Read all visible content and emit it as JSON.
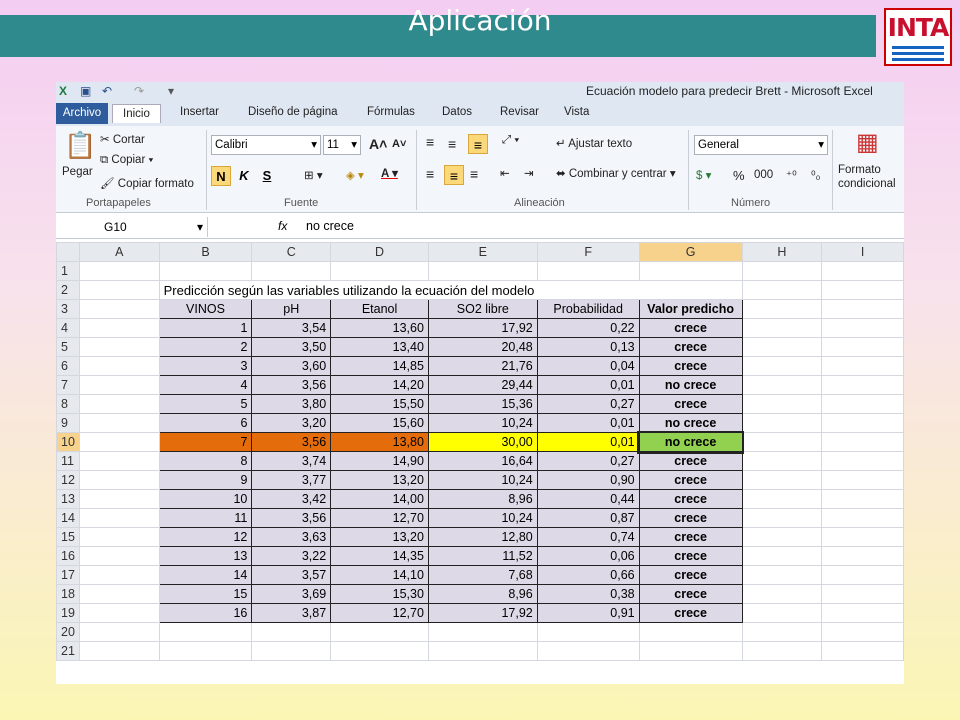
{
  "slide": {
    "title": "Aplicación",
    "logo": "INTA"
  },
  "colors": {
    "title_bar": "#2f8a8d",
    "data_fill": "#ddd9e6",
    "highlight_row": "#e56c0a",
    "highlight_yellow": "#ffff00",
    "selected_cell": "#92d050"
  },
  "window": {
    "title": "Ecuación modelo para predecir Brett - Microsoft Excel"
  },
  "ribbon": {
    "tabs": [
      "Archivo",
      "Inicio",
      "Insertar",
      "Diseño de página",
      "Fórmulas",
      "Datos",
      "Revisar",
      "Vista"
    ],
    "clipboard": {
      "paste": "Pegar",
      "cut": "Cortar",
      "copy": "Copiar",
      "format_painter": "Copiar formato",
      "label": "Portapapeles"
    },
    "font": {
      "name": "Calibri",
      "size": "11",
      "bold": "N",
      "italic": "K",
      "underline": "S",
      "label": "Fuente"
    },
    "alignment": {
      "wrap": "Ajustar texto",
      "merge": "Combinar y centrar",
      "label": "Alineación"
    },
    "number": {
      "format": "General",
      "percent": "%",
      "thousands": "000",
      "label": "Número"
    },
    "styles": {
      "conditional_line1": "Formato",
      "conditional_line2": "condicional"
    }
  },
  "formula_bar": {
    "cell_ref": "G10",
    "fx": "fx",
    "value": "no crece"
  },
  "sheet": {
    "columns": [
      "A",
      "B",
      "C",
      "D",
      "E",
      "F",
      "G",
      "H",
      "I"
    ],
    "selected_column": "G",
    "selected_row": 10,
    "caption": "Predicción según las variables utilizando la ecuación del modelo",
    "headers": [
      "VINOS",
      "pH",
      "Etanol",
      "SO2 libre",
      "Probabilidad",
      "Valor predicho"
    ],
    "rows": [
      [
        "1",
        "3,54",
        "13,60",
        "17,92",
        "0,22",
        "crece"
      ],
      [
        "2",
        "3,50",
        "13,40",
        "20,48",
        "0,13",
        "crece"
      ],
      [
        "3",
        "3,60",
        "14,85",
        "21,76",
        "0,04",
        "crece"
      ],
      [
        "4",
        "3,56",
        "14,20",
        "29,44",
        "0,01",
        "no crece"
      ],
      [
        "5",
        "3,80",
        "15,50",
        "15,36",
        "0,27",
        "crece"
      ],
      [
        "6",
        "3,20",
        "15,60",
        "10,24",
        "0,01",
        "no crece"
      ],
      [
        "7",
        "3,56",
        "13,80",
        "30,00",
        "0,01",
        "no crece"
      ],
      [
        "8",
        "3,74",
        "14,90",
        "16,64",
        "0,27",
        "crece"
      ],
      [
        "9",
        "3,77",
        "13,20",
        "10,24",
        "0,90",
        "crece"
      ],
      [
        "10",
        "3,42",
        "14,00",
        "8,96",
        "0,44",
        "crece"
      ],
      [
        "11",
        "3,56",
        "12,70",
        "10,24",
        "0,87",
        "crece"
      ],
      [
        "12",
        "3,63",
        "13,20",
        "12,80",
        "0,74",
        "crece"
      ],
      [
        "13",
        "3,22",
        "14,35",
        "11,52",
        "0,06",
        "crece"
      ],
      [
        "14",
        "3,57",
        "14,10",
        "7,68",
        "0,66",
        "crece"
      ],
      [
        "15",
        "3,69",
        "15,30",
        "8,96",
        "0,38",
        "crece"
      ],
      [
        "16",
        "3,87",
        "12,70",
        "17,92",
        "0,91",
        "crece"
      ]
    ],
    "row_numbers": [
      "1",
      "2",
      "3",
      "4",
      "5",
      "6",
      "7",
      "8",
      "9",
      "10",
      "11",
      "12",
      "13",
      "14",
      "15",
      "16",
      "17",
      "18",
      "19",
      "20",
      "21"
    ]
  }
}
